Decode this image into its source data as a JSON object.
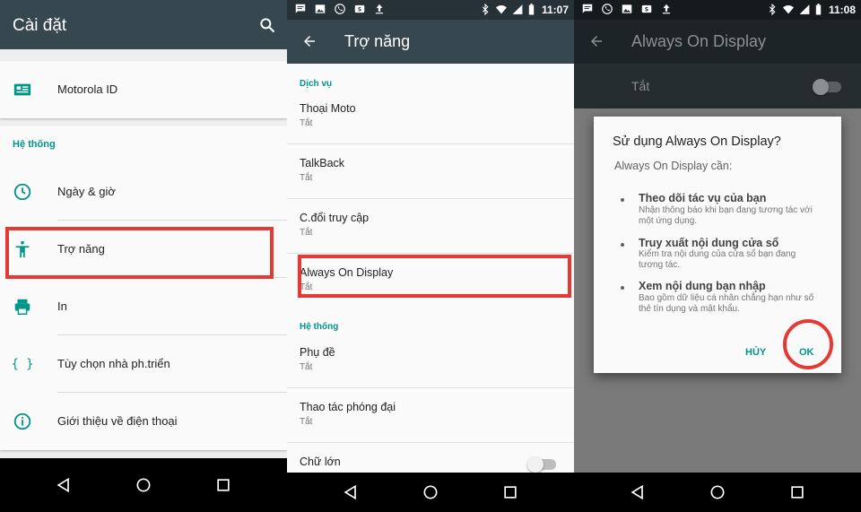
{
  "settings_panel": {
    "title": "Cài đặt",
    "items_top": [
      {
        "label": "Motorola ID",
        "icon": "account-card-icon"
      }
    ],
    "section_system": "Hệ thống",
    "items": [
      {
        "label": "Ngày & giờ",
        "icon": "clock-icon"
      },
      {
        "label": "Trợ năng",
        "icon": "accessibility-icon"
      },
      {
        "label": "In",
        "icon": "print-icon"
      },
      {
        "label": "Tùy chọn nhà ph.triển",
        "icon": "braces-icon"
      },
      {
        "label": "Giới thiệu về điện thoại",
        "icon": "info-icon"
      }
    ]
  },
  "accessibility_panel": {
    "status_time": "11:07",
    "title": "Trợ năng",
    "section_services": "Dịch vụ",
    "services": [
      {
        "title": "Thoại Moto",
        "status": "Tắt"
      },
      {
        "title": "TalkBack",
        "status": "Tắt"
      },
      {
        "title": "C.đổi truy cập",
        "status": "Tắt"
      },
      {
        "title": "Always On Display",
        "status": "Tắt"
      }
    ],
    "section_system": "Hệ thống",
    "system_items": [
      {
        "title": "Phụ đề",
        "status": "Tắt"
      },
      {
        "title": "Thao tác phóng đại",
        "status": "Tắt"
      },
      {
        "title": "Chữ lớn",
        "status": ""
      }
    ]
  },
  "dialog_panel": {
    "status_time": "11:08",
    "title": "Always On Display",
    "toggle_label": "Tắt",
    "dialog": {
      "title": "Sử dụng Always On Display?",
      "subtitle": "Always On Display cần:",
      "permissions": [
        {
          "title": "Theo dõi tác vụ của bạn",
          "desc": "Nhận thông báo khi bạn đang tương tác với một ứng dụng."
        },
        {
          "title": "Truy xuất nội dung cửa sổ",
          "desc": "Kiểm tra nội dung của cửa sổ bạn đang tương tác."
        },
        {
          "title": "Xem nội dung bạn nhập",
          "desc": "Bao gồm dữ liệu cá nhân chẳng hạn như số thẻ tín dụng và mật khẩu."
        }
      ],
      "cancel_label": "HỦY",
      "ok_label": "OK"
    }
  },
  "colors": {
    "toolbar": "#37474f",
    "statusbar": "#263238",
    "accent": "#009688",
    "highlight": "#e53935"
  }
}
